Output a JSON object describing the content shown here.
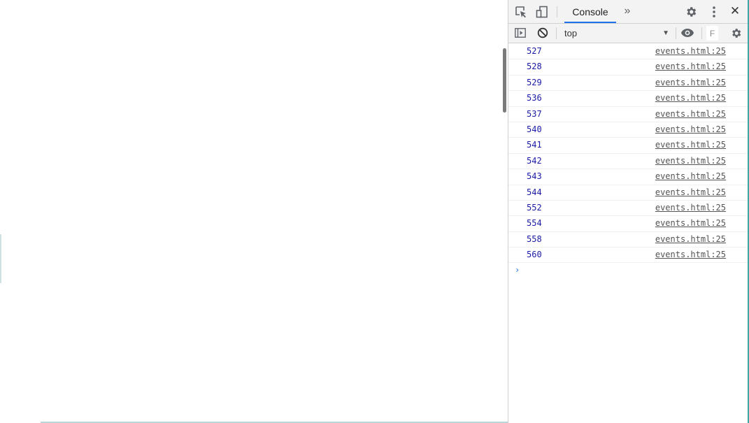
{
  "devtools": {
    "toolbar": {
      "inspect_icon": "inspect-element-icon",
      "device_icon": "device-toolbar-icon",
      "active_tab": "Console",
      "more_tabs_label": "»",
      "settings_icon": "gear-icon",
      "menu_icon": "more-vertical-icon",
      "close_label": "✕"
    },
    "console_toolbar": {
      "sidebar_icon": "show-sidebar-icon",
      "clear_icon": "clear-console-icon",
      "context_value": "top",
      "context_arrow": "▼",
      "live_expression_icon": "eye-icon",
      "filter_placeholder": "F",
      "settings_icon": "gear-icon"
    },
    "messages": [
      {
        "value": "527",
        "source": "events.html:25"
      },
      {
        "value": "528",
        "source": "events.html:25"
      },
      {
        "value": "529",
        "source": "events.html:25"
      },
      {
        "value": "536",
        "source": "events.html:25"
      },
      {
        "value": "537",
        "source": "events.html:25"
      },
      {
        "value": "540",
        "source": "events.html:25"
      },
      {
        "value": "541",
        "source": "events.html:25"
      },
      {
        "value": "542",
        "source": "events.html:25"
      },
      {
        "value": "543",
        "source": "events.html:25"
      },
      {
        "value": "544",
        "source": "events.html:25"
      },
      {
        "value": "552",
        "source": "events.html:25"
      },
      {
        "value": "554",
        "source": "events.html:25"
      },
      {
        "value": "558",
        "source": "events.html:25"
      },
      {
        "value": "560",
        "source": "events.html:25"
      }
    ],
    "prompt_symbol": "›",
    "accent_color": "#1a73e8",
    "value_color": "#1a1aa6"
  }
}
